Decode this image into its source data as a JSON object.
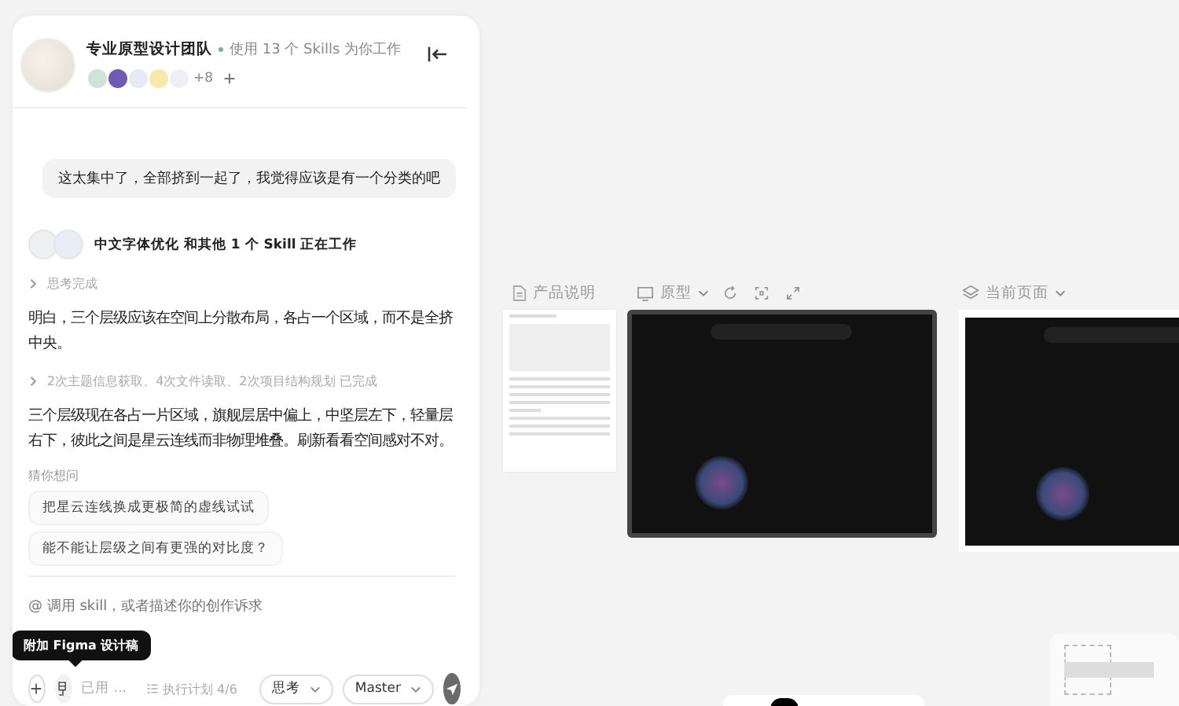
{
  "team": {
    "name": "专业原型设计团队",
    "status": "使用 13 个 Skills 为你工作",
    "more_members": "+8"
  },
  "feed": [
    {
      "kind": "user",
      "text": "这太集中了，全部挤到一起了，我觉得应该是有一个分类的吧"
    },
    {
      "kind": "skills",
      "text": "中文字体优化 和其他 1 个 Skill 正在工作"
    },
    {
      "kind": "step",
      "text": "思考完成",
      "expanded": false
    },
    {
      "kind": "reply",
      "text": "明白，三个层级应该在空间上分散布局，各占一个区域，而不是全挤中央。"
    },
    {
      "kind": "step",
      "text": "2次主题信息获取、4次文件读取、2次项目结构规划 已完成",
      "expanded": false
    },
    {
      "kind": "reply",
      "text": "三个层级现在各占一片区域，旗舰层居中偏上，中坚层左下，轻量层右下，彼此之间是星云连线而非物理堆叠。刷新看看空间感对不对。"
    }
  ],
  "suggestions": {
    "title": "猜你想问",
    "items": [
      "把星云连线换成更极简的虚线试试",
      "能不能让层级之间有更强的对比度？"
    ]
  },
  "composer": {
    "placeholder": "@ 调用 skill，或者描述你的创作诉求",
    "tooltip": "附加 Figma 设计稿",
    "skills_used": "已用 ...",
    "plan": "执行计划 4/6",
    "mode": "思考",
    "branch": "Master"
  },
  "canvas": {
    "doc_label": "产品说明",
    "prototype_label": "原型",
    "page_label": "当前页面"
  }
}
